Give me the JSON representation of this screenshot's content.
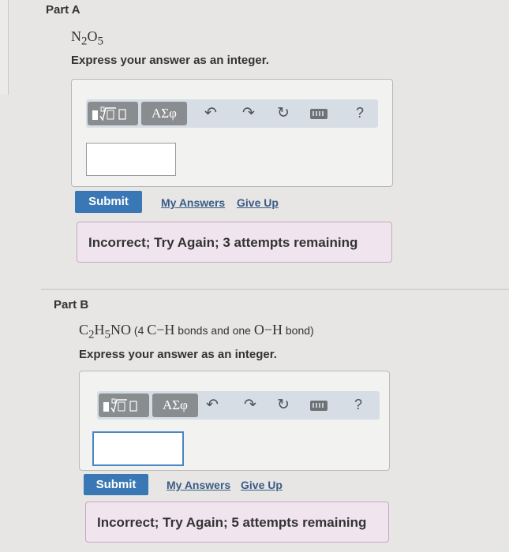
{
  "partA": {
    "title": "Part A",
    "formula": {
      "c1": "N",
      "s1": "2",
      "c2": "O",
      "s2": "5"
    },
    "instruction": "Express your answer as an integer.",
    "toolbar": {
      "greek": "ΑΣφ",
      "undo": "↶",
      "redo": "↷",
      "reset": "↻",
      "help": "?"
    },
    "input_value": "",
    "submit_label": "Submit",
    "my_answers_label": "My Answers",
    "give_up_label": "Give Up",
    "feedback": "Incorrect; Try Again; 3 attempts remaining"
  },
  "partB": {
    "title": "Part B",
    "formula": {
      "c1": "C",
      "s1": "2",
      "c2": "H",
      "s2": "5",
      "c3": "NO",
      "p1": " (4 ",
      "b1": "C",
      "d1": "−",
      "b2": "H",
      "p2": " bonds and one ",
      "b3": "O",
      "d2": "−",
      "b4": "H",
      "p3": " bond)"
    },
    "instruction": "Express your answer as an integer.",
    "toolbar": {
      "greek": "ΑΣφ",
      "undo": "↶",
      "redo": "↷",
      "reset": "↻",
      "help": "?"
    },
    "input_value": "",
    "submit_label": "Submit",
    "my_answers_label": "My Answers",
    "give_up_label": "Give Up",
    "feedback": "Incorrect; Try Again; 5 attempts remaining"
  },
  "colors": {
    "submit": "#3978b4",
    "toolbar": "#d6dde5",
    "feedback_bg": "#f0e4ee",
    "link": "#3a5b86"
  }
}
